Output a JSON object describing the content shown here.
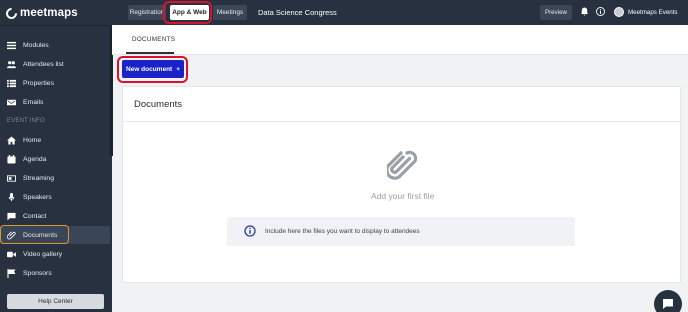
{
  "brand": {
    "name": "meetmaps"
  },
  "sidebar": {
    "items": [
      {
        "label": "Modules",
        "icon": "menu-icon"
      },
      {
        "label": "Attendees list",
        "icon": "users-icon"
      },
      {
        "label": "Properties",
        "icon": "list-icon"
      },
      {
        "label": "Emails",
        "icon": "mail-icon"
      }
    ],
    "section_label": "EVENT INFO",
    "event_items": [
      {
        "label": "Home",
        "icon": "home-icon"
      },
      {
        "label": "Agenda",
        "icon": "calendar-icon"
      },
      {
        "label": "Streaming",
        "icon": "tv-icon"
      },
      {
        "label": "Speakers",
        "icon": "microphone-icon"
      },
      {
        "label": "Contact",
        "icon": "chat-icon"
      },
      {
        "label": "Documents",
        "icon": "paperclip-icon",
        "active": true
      },
      {
        "label": "Video gallery",
        "icon": "video-icon"
      },
      {
        "label": "Sponsors",
        "icon": "flag-icon"
      }
    ],
    "help_label": "Help Center"
  },
  "topbar": {
    "tabs": [
      {
        "label": "Registration"
      },
      {
        "label": "App & Web",
        "active": true
      },
      {
        "label": "Meetings"
      }
    ],
    "event_title": "Data Science Congress",
    "preview_label": "Preview",
    "user_name": "Meetmaps Events"
  },
  "content": {
    "tab_label": "DOCUMENTS",
    "new_button_label": "New document",
    "new_button_icon": "+",
    "card_title": "Documents",
    "empty_text": "Add your first file",
    "info_text": "Include here the files you want to display to attendees"
  },
  "colors": {
    "sidebar_bg": "#273140",
    "accent": "#1a23c7",
    "highlight": "#d8132c"
  }
}
